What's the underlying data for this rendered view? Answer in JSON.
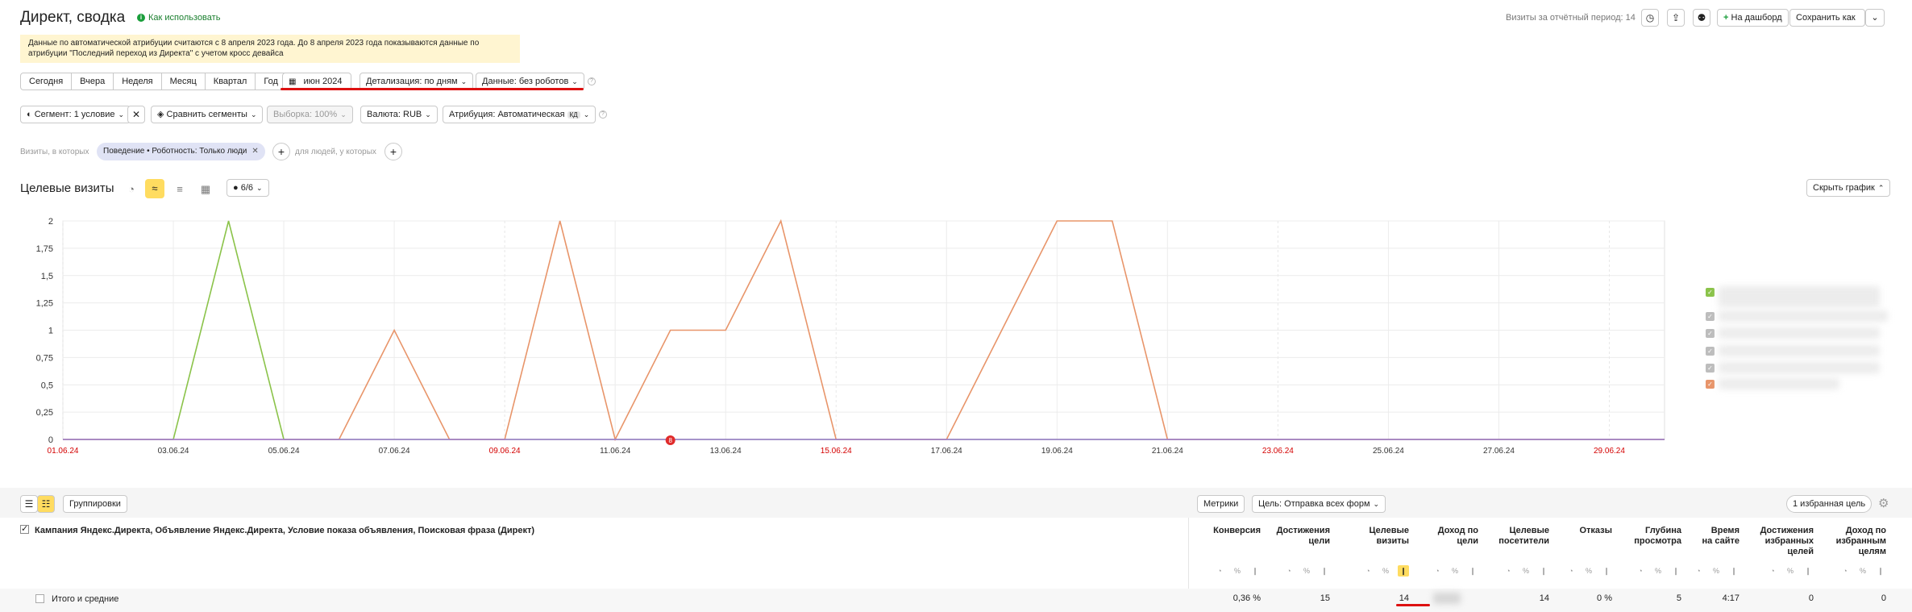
{
  "header": {
    "title": "Директ, сводка",
    "help_link": "Как использовать",
    "visits_label": "Визиты за отчётный период: 14",
    "dashboard_button": "На дашборд",
    "save_button": "Сохранить как"
  },
  "notice": {
    "line1": "Данные по автоматической атрибуции считаются с 8 апреля 2023 года. До 8 апреля 2023 года показываются данные по",
    "line2": "атрибуции \"Последний переход из Директа\" с учетом кросс девайса"
  },
  "periods": [
    "Сегодня",
    "Вчера",
    "Неделя",
    "Месяц",
    "Квартал",
    "Год"
  ],
  "filters": {
    "date": "июн 2024",
    "detail": "Детализация: по дням",
    "data": "Данные: без роботов"
  },
  "toolbar2": {
    "segment": "Сегмент: 1 условие",
    "compare": "Сравнить сегменты",
    "sample": "Выборка: 100%",
    "currency": "Валюта: RUB",
    "attribution": "Атрибуция: Автоматическая",
    "attribution_badge": "КД"
  },
  "condition": {
    "prefix": "Визиты, в которых",
    "tag": "Поведение • Роботность: Только люди",
    "suffix": "для людей, у которых"
  },
  "chart_section": {
    "title": "Целевые визиты",
    "series_count": "6/6",
    "hide_button": "Скрыть график"
  },
  "chart_data": {
    "type": "line",
    "ylim": [
      0,
      2
    ],
    "yticks": [
      "0",
      "0,25",
      "0,5",
      "0,75",
      "1",
      "1,25",
      "1,5",
      "1,75",
      "2"
    ],
    "x": [
      "01.06.24",
      "02.06.24",
      "03.06.24",
      "04.06.24",
      "05.06.24",
      "06.06.24",
      "07.06.24",
      "08.06.24",
      "09.06.24",
      "10.06.24",
      "11.06.24",
      "12.06.24",
      "13.06.24",
      "14.06.24",
      "15.06.24",
      "16.06.24",
      "17.06.24",
      "18.06.24",
      "19.06.24",
      "20.06.24",
      "21.06.24",
      "22.06.24",
      "23.06.24",
      "24.06.24",
      "25.06.24",
      "26.06.24",
      "27.06.24",
      "28.06.24",
      "29.06.24",
      "30.06.24"
    ],
    "xtick_labels": [
      {
        "label": "01.06.24",
        "idx": 0,
        "weekend": true
      },
      {
        "label": "03.06.24",
        "idx": 2,
        "weekend": false
      },
      {
        "label": "05.06.24",
        "idx": 4,
        "weekend": false
      },
      {
        "label": "07.06.24",
        "idx": 6,
        "weekend": false
      },
      {
        "label": "09.06.24",
        "idx": 8,
        "weekend": true
      },
      {
        "label": "11.06.24",
        "idx": 10,
        "weekend": false
      },
      {
        "label": "13.06.24",
        "idx": 12,
        "weekend": false
      },
      {
        "label": "15.06.24",
        "idx": 14,
        "weekend": true
      },
      {
        "label": "17.06.24",
        "idx": 16,
        "weekend": false
      },
      {
        "label": "19.06.24",
        "idx": 18,
        "weekend": false
      },
      {
        "label": "21.06.24",
        "idx": 20,
        "weekend": false
      },
      {
        "label": "23.06.24",
        "idx": 22,
        "weekend": true
      },
      {
        "label": "25.06.24",
        "idx": 24,
        "weekend": false
      },
      {
        "label": "27.06.24",
        "idx": 26,
        "weekend": false
      },
      {
        "label": "29.06.24",
        "idx": 28,
        "weekend": true
      }
    ],
    "series": [
      {
        "color": "#8bc34a",
        "values": [
          0,
          0,
          0,
          2,
          0,
          0,
          0,
          0,
          0,
          0,
          0,
          0,
          0,
          0,
          0,
          0,
          0,
          0,
          0,
          0,
          0,
          0,
          0,
          0,
          0,
          0,
          0,
          0,
          0,
          0
        ]
      },
      {
        "color": "#e8956a",
        "values": [
          0,
          0,
          0,
          0,
          0,
          0,
          1,
          0,
          0,
          2,
          0,
          1,
          1,
          2,
          0,
          0,
          0,
          1,
          2,
          2,
          0,
          0,
          0,
          0,
          0,
          0,
          0,
          0,
          0,
          0
        ]
      },
      {
        "color": "#9c7bd6",
        "values": [
          0,
          0,
          0,
          0,
          0,
          0,
          0,
          0,
          0,
          0,
          0,
          0,
          0,
          0,
          0,
          0,
          0,
          0,
          0,
          0,
          0,
          0,
          0,
          0,
          0,
          0,
          0,
          0,
          0,
          0
        ]
      }
    ],
    "marker": {
      "idx": 11,
      "label": "8"
    }
  },
  "legend": [
    {
      "color": "#8bc34a",
      "checked": true
    },
    {
      "color": "#bdbdbd",
      "checked": true
    },
    {
      "color": "#bdbdbd",
      "checked": true
    },
    {
      "color": "#bdbdbd",
      "checked": true
    },
    {
      "color": "#bdbdbd",
      "checked": true
    },
    {
      "color": "#e8956a",
      "checked": true
    }
  ],
  "table": {
    "groupings_button": "Группировки",
    "metrics_button": "Метрики",
    "goal_select": "Цель: Отправка всех форм",
    "favorites_button": "1 избранная цель",
    "group_header": "Кампания Яндекс.Директа, Объявление Яндекс.Директа, Условие показа объявления, Поисковая фраза (Директ)",
    "total_label": "Итого и средние",
    "metrics": [
      {
        "l1": "Конверсия",
        "l2": "",
        "value": "0,36 %"
      },
      {
        "l1": "Достижения",
        "l2": "цели",
        "value": "15"
      },
      {
        "l1": "Целевые",
        "l2": "визиты",
        "value": "14"
      },
      {
        "l1": "Доход по",
        "l2": "цели",
        "value": ""
      },
      {
        "l1": "Целевые",
        "l2": "посетители",
        "value": "14"
      },
      {
        "l1": "Отказы",
        "l2": "",
        "value": "0 %"
      },
      {
        "l1": "Глубина",
        "l2": "просмотра",
        "value": "5"
      },
      {
        "l1": "Время",
        "l2": "на сайте",
        "value": "4:17"
      },
      {
        "l1": "Достижения",
        "l2": "избранных",
        "l3": "целей",
        "value": "0"
      },
      {
        "l1": "Доход по",
        "l2": "избранным",
        "l3": "целям",
        "value": "0"
      }
    ]
  }
}
